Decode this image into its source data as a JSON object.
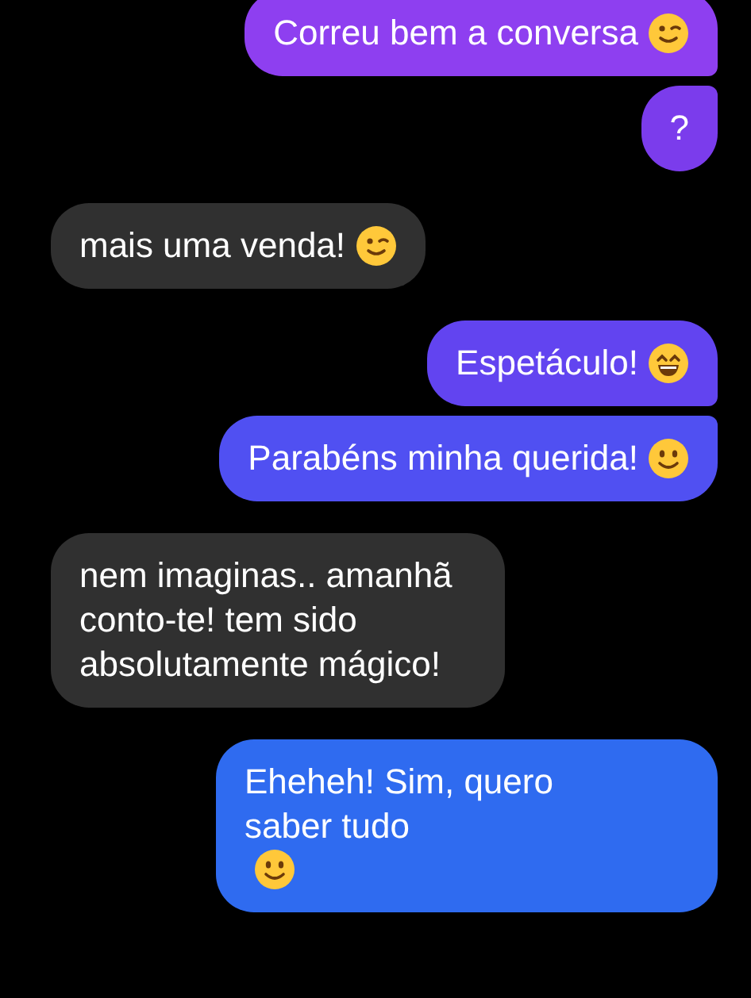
{
  "messages": [
    {
      "kind": "sent",
      "text": "Correu bem a conversa",
      "emoji": {
        "kind": "wink"
      },
      "color": "#8e3ff0"
    },
    {
      "kind": "sent",
      "text": "?",
      "color": "#7b3cec"
    },
    {
      "kind": "received",
      "text": "mais uma venda!",
      "emoji": {
        "kind": "wink"
      },
      "color": "#303030"
    },
    {
      "kind": "sent",
      "text": "Espetáculo!",
      "emoji": {
        "kind": "grin"
      },
      "color": "#6244f0"
    },
    {
      "kind": "sent",
      "text": "Parabéns minha querida!",
      "emoji": {
        "kind": "smile"
      },
      "color": "#5050f2"
    },
    {
      "kind": "received",
      "text": "nem imaginas.. amanhã conto-te! tem sido absolutamente mágico!",
      "color": "#303030"
    },
    {
      "kind": "sent",
      "text": "Eheheh! Sim, quero saber tudo",
      "emoji": {
        "kind": "smile"
      },
      "color": "#2f6bf0"
    }
  ]
}
